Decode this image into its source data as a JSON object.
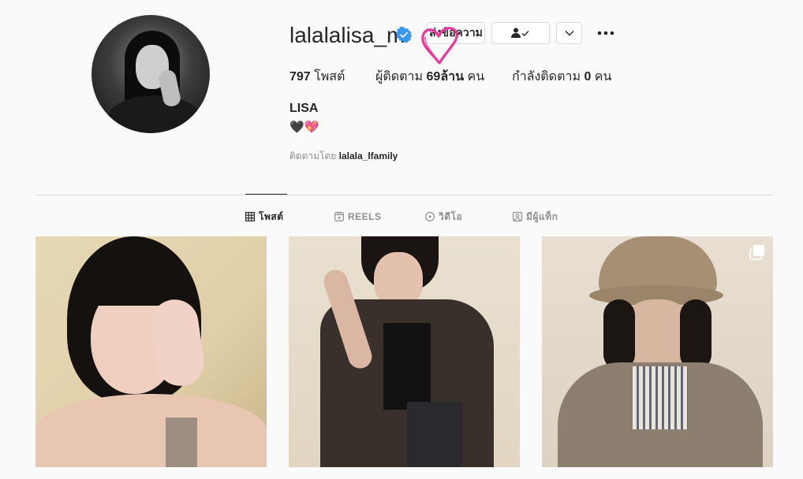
{
  "profile": {
    "username": "lalalalisa_m",
    "verified": true,
    "full_name": "LISA",
    "bio": "🖤💖",
    "followed_by_prefix": "ติดตามโดย",
    "followed_by_user": "lalala_lfamily"
  },
  "buttons": {
    "message_label": "ส่งข้อความ",
    "following_icon": "person-check-icon",
    "dropdown_icon": "chevron-down-icon",
    "more_icon": "more-dots-icon"
  },
  "stats": {
    "posts_count": "797",
    "posts_label": " โพสต์",
    "followers_prefix": "ผู้ติดตาม ",
    "followers_count": "69ล้าน",
    "followers_suffix": " คน",
    "following_prefix": "กำลังติดตาม ",
    "following_count": "0",
    "following_suffix": " คน"
  },
  "tabs": [
    {
      "label": "โพสต์",
      "icon": "grid-icon",
      "active": true
    },
    {
      "label": "REELS",
      "icon": "reels-icon",
      "active": false
    },
    {
      "label": "วิดีโอ",
      "icon": "video-icon",
      "active": false
    },
    {
      "label": "มีผู้แท็ก",
      "icon": "tagged-icon",
      "active": false
    }
  ],
  "posts": [
    {
      "type": "single"
    },
    {
      "type": "single"
    },
    {
      "type": "carousel",
      "icon": "carousel-icon"
    }
  ],
  "colors": {
    "verified_blue": "#3897f0",
    "heart_pink": "#e8389a",
    "text": "#262626",
    "muted": "#8e8e8e",
    "border": "#dbdbdb"
  }
}
